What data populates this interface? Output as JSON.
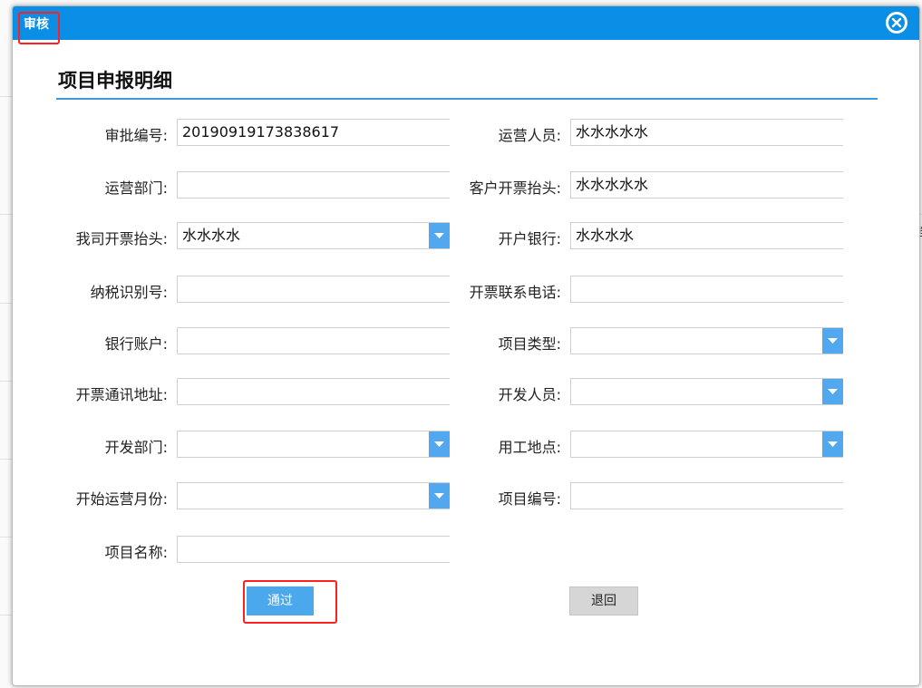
{
  "dialog": {
    "title": "审核",
    "close_icon": "close-circle-icon",
    "section_title": "项目申报明细"
  },
  "background": {
    "edge_char": "档"
  },
  "left_fields": [
    {
      "label": "审批编号:",
      "value": "20190919173838617",
      "type": "text"
    },
    {
      "label": "运营部门:",
      "value": "",
      "type": "text"
    },
    {
      "label": "我司开票抬头:",
      "value": "水水水水",
      "type": "select"
    },
    {
      "label": "纳税识别号:",
      "value": "",
      "type": "text"
    },
    {
      "label": "银行账户:",
      "value": "",
      "type": "text"
    },
    {
      "label": "开票通讯地址:",
      "value": "",
      "type": "text"
    },
    {
      "label": "开发部门:",
      "value": "",
      "type": "select"
    },
    {
      "label": "开始运营月份:",
      "value": "",
      "type": "select"
    },
    {
      "label": "项目名称:",
      "value": "",
      "type": "text"
    }
  ],
  "right_fields": [
    {
      "label": "运营人员:",
      "value": "水水水水水",
      "type": "text"
    },
    {
      "label": "客户开票抬头:",
      "value": "水水水水水",
      "type": "text"
    },
    {
      "label": "开户银行:",
      "value": "水水水水",
      "type": "text"
    },
    {
      "label": "开票联系电话:",
      "value": "",
      "type": "text"
    },
    {
      "label": "项目类型:",
      "value": "",
      "type": "select"
    },
    {
      "label": "开发人员:",
      "value": "",
      "type": "select"
    },
    {
      "label": "用工地点:",
      "value": "",
      "type": "select"
    },
    {
      "label": "项目编号:",
      "value": "",
      "type": "text"
    }
  ],
  "buttons": {
    "pass_label": "通过",
    "back_label": "退回"
  },
  "colors": {
    "titlebar": "#0a8ee6",
    "accent": "#4ba8ec",
    "highlight": "#ff2020"
  }
}
